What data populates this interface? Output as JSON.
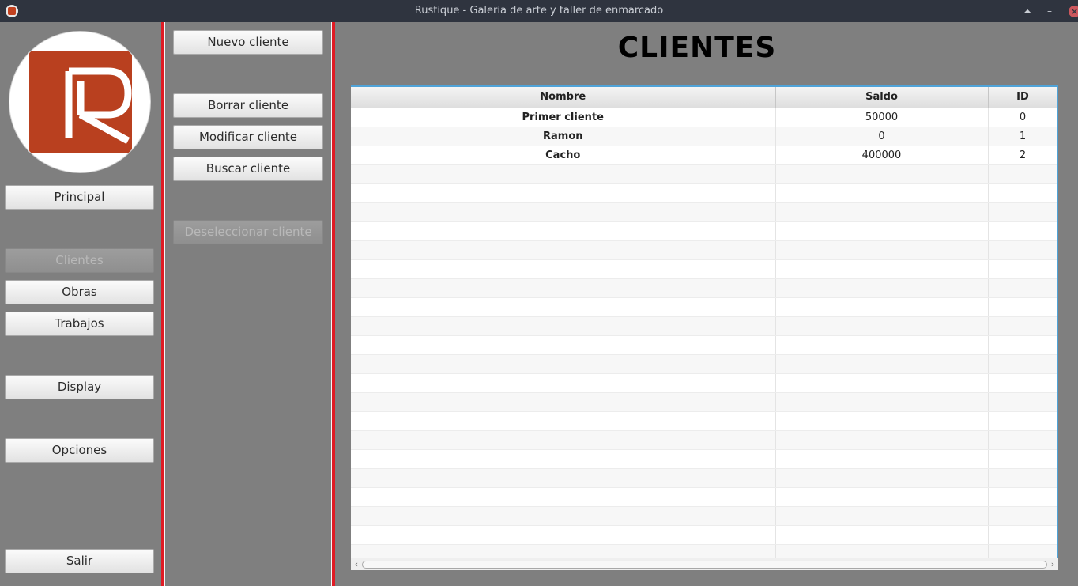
{
  "window": {
    "title": "Rustique - Galeria de arte y taller de enmarcado",
    "minimize_glyph": "–",
    "maximize_glyph": "⏶",
    "close_glyph": "×"
  },
  "nav": {
    "principal": "Principal",
    "clientes": "Clientes",
    "obras": "Obras",
    "trabajos": "Trabajos",
    "display": "Display",
    "opciones": "Opciones",
    "salir": "Salir"
  },
  "actions": {
    "nuevo": "Nuevo cliente",
    "borrar": "Borrar cliente",
    "modificar": "Modificar cliente",
    "buscar": "Buscar cliente",
    "deseleccionar": "Deseleccionar cliente"
  },
  "page": {
    "heading": "CLIENTES"
  },
  "table": {
    "columns": [
      "Nombre",
      "Saldo",
      "ID"
    ],
    "rows": [
      [
        "Primer cliente",
        "50000",
        "0"
      ],
      [
        "Ramon",
        "0",
        "1"
      ],
      [
        "Cacho",
        "400000",
        "2"
      ]
    ]
  },
  "colors": {
    "brand_red": "#b9401f",
    "separator_red": "#e01b24",
    "background": "#7f7f7f",
    "titlebar": "#2f343f"
  }
}
